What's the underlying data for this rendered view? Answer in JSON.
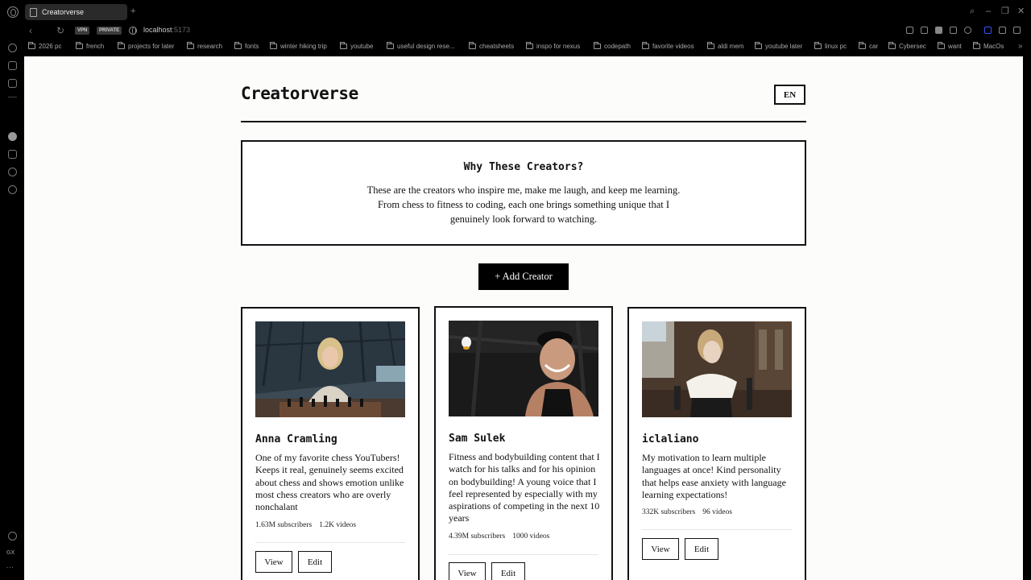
{
  "browser": {
    "tab_title": "Creatorverse",
    "new_tab": "+",
    "badges": {
      "vpn": "VPN",
      "private": "PRIVATE"
    },
    "url_host": "localhost",
    "url_port": ":5173",
    "bookmarks": [
      "2026 pc",
      "french",
      "projects for later",
      "research",
      "fonts",
      "winter hiking trip",
      "youtube",
      "useful design rese...",
      "cheatsheets",
      "inspo for nexus",
      "codepath",
      "favorite videos",
      "aldi mem",
      "youtube later",
      "linux pc",
      "car",
      "Cybersec",
      "want",
      "MacOs"
    ],
    "more": "»",
    "sidebar_bottom": "GX"
  },
  "header": {
    "title": "Creatorverse",
    "lang_button": "EN"
  },
  "intro": {
    "heading": "Why These Creators?",
    "text": "These are the creators who inspire me, make me laugh, and keep me learning. From chess to fitness to coding, each one brings something unique that I genuinely look forward to watching."
  },
  "add_button": "+ Add Creator",
  "creators": [
    {
      "name": "Anna Cramling",
      "description": "One of my favorite chess YouTubers! Keeps it real, genuinely seems excited about chess and shows emotion unlike most chess creators who are overly nonchalant",
      "subscribers": "1.63M subscribers",
      "videos": "1.2K videos",
      "view": "View",
      "edit": "Edit"
    },
    {
      "name": "Sam Sulek",
      "description": "Fitness and bodybuilding content that I watch for his talks and for his opinion on bodybuilding! A young voice that I feel represented by especially with my aspirations of competing in the next 10 years",
      "subscribers": "4.39M subscribers",
      "videos": "1000 videos",
      "view": "View",
      "edit": "Edit"
    },
    {
      "name": "iclaliano",
      "description": "My motivation to learn multiple languages at once! Kind personality that helps ease anxiety with language learning expectations!",
      "subscribers": "332K subscribers",
      "videos": "96 videos",
      "view": "View",
      "edit": "Edit"
    }
  ]
}
